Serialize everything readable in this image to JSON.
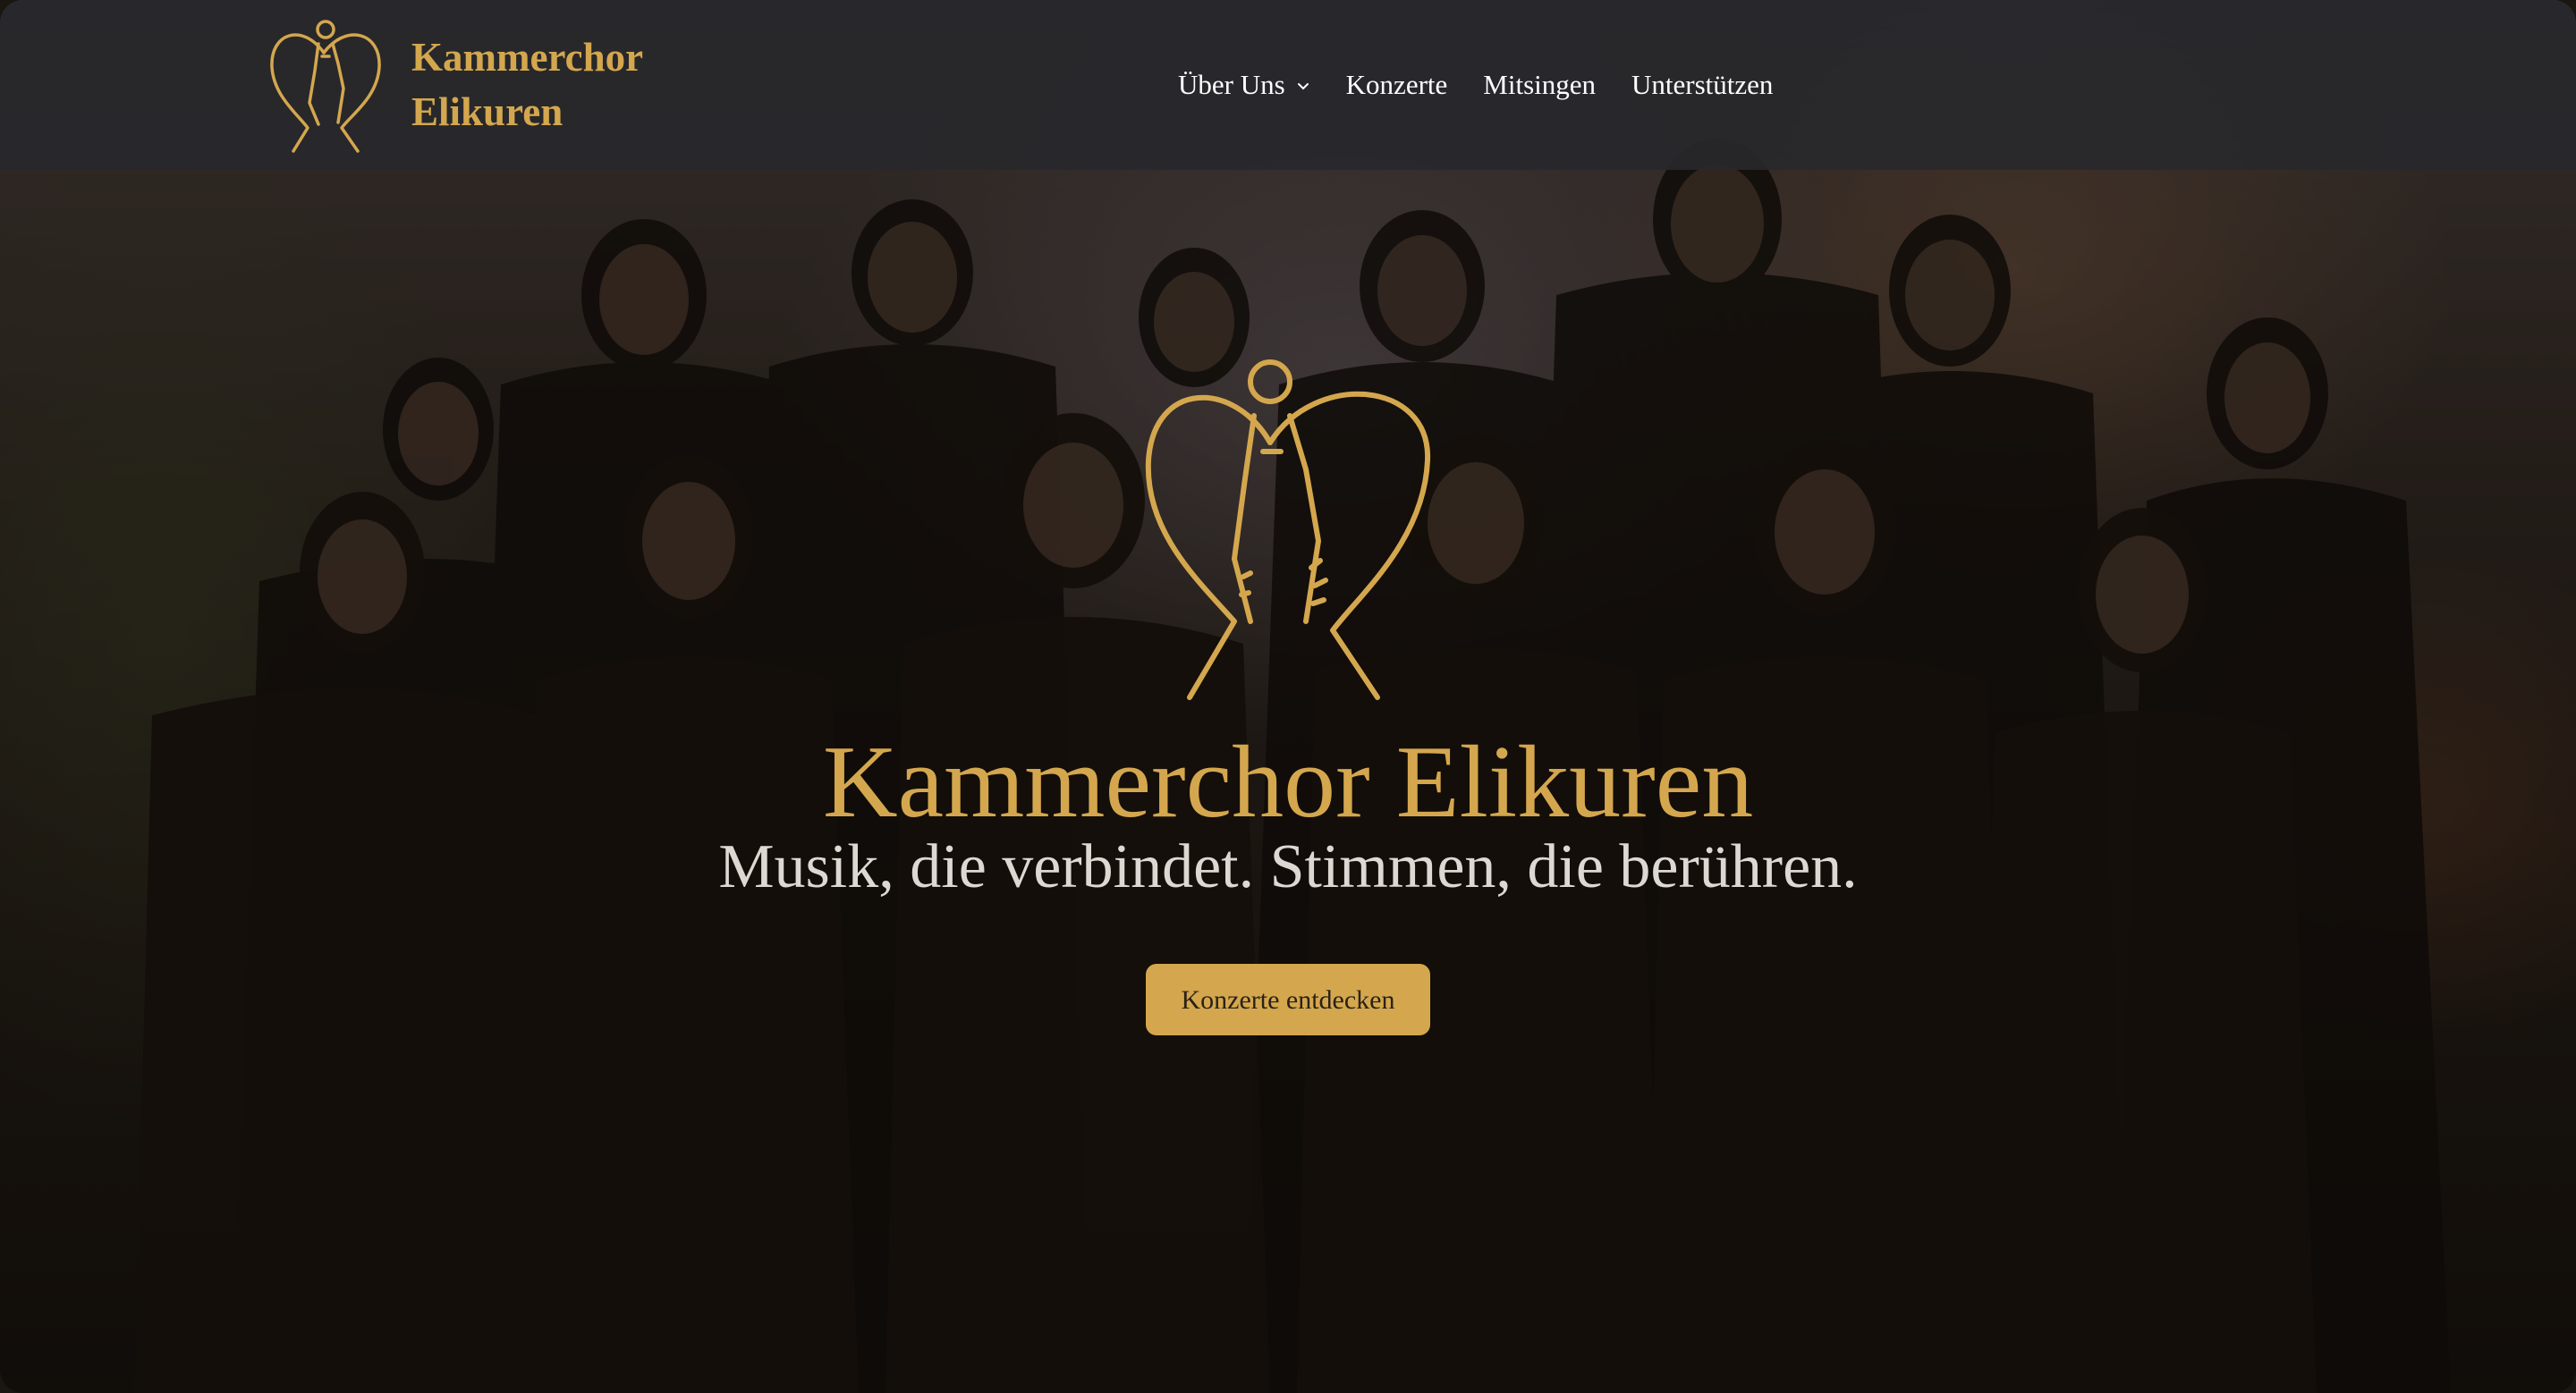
{
  "header": {
    "brand_line1": "Kammerchor",
    "brand_line2": "Elikuren",
    "logo_icon": "angel-heart-icon",
    "nav": [
      {
        "label": "Über Uns",
        "has_dropdown": true
      },
      {
        "label": "Konzerte",
        "has_dropdown": false
      },
      {
        "label": "Mitsingen",
        "has_dropdown": false
      },
      {
        "label": "Unterstützen",
        "has_dropdown": false
      }
    ]
  },
  "hero": {
    "title": "Kammerchor Elikuren",
    "subtitle": "Musik, die verbindet. Stimmen, die berühren.",
    "cta_label": "Konzerte entdecken",
    "background_image": "choir-group-photo"
  },
  "colors": {
    "accent": "#d4a74e",
    "header_bg": "#28282c",
    "nav_text": "#ffffff",
    "subtitle_text": "#ddd8d2",
    "button_text": "#2a2218"
  }
}
